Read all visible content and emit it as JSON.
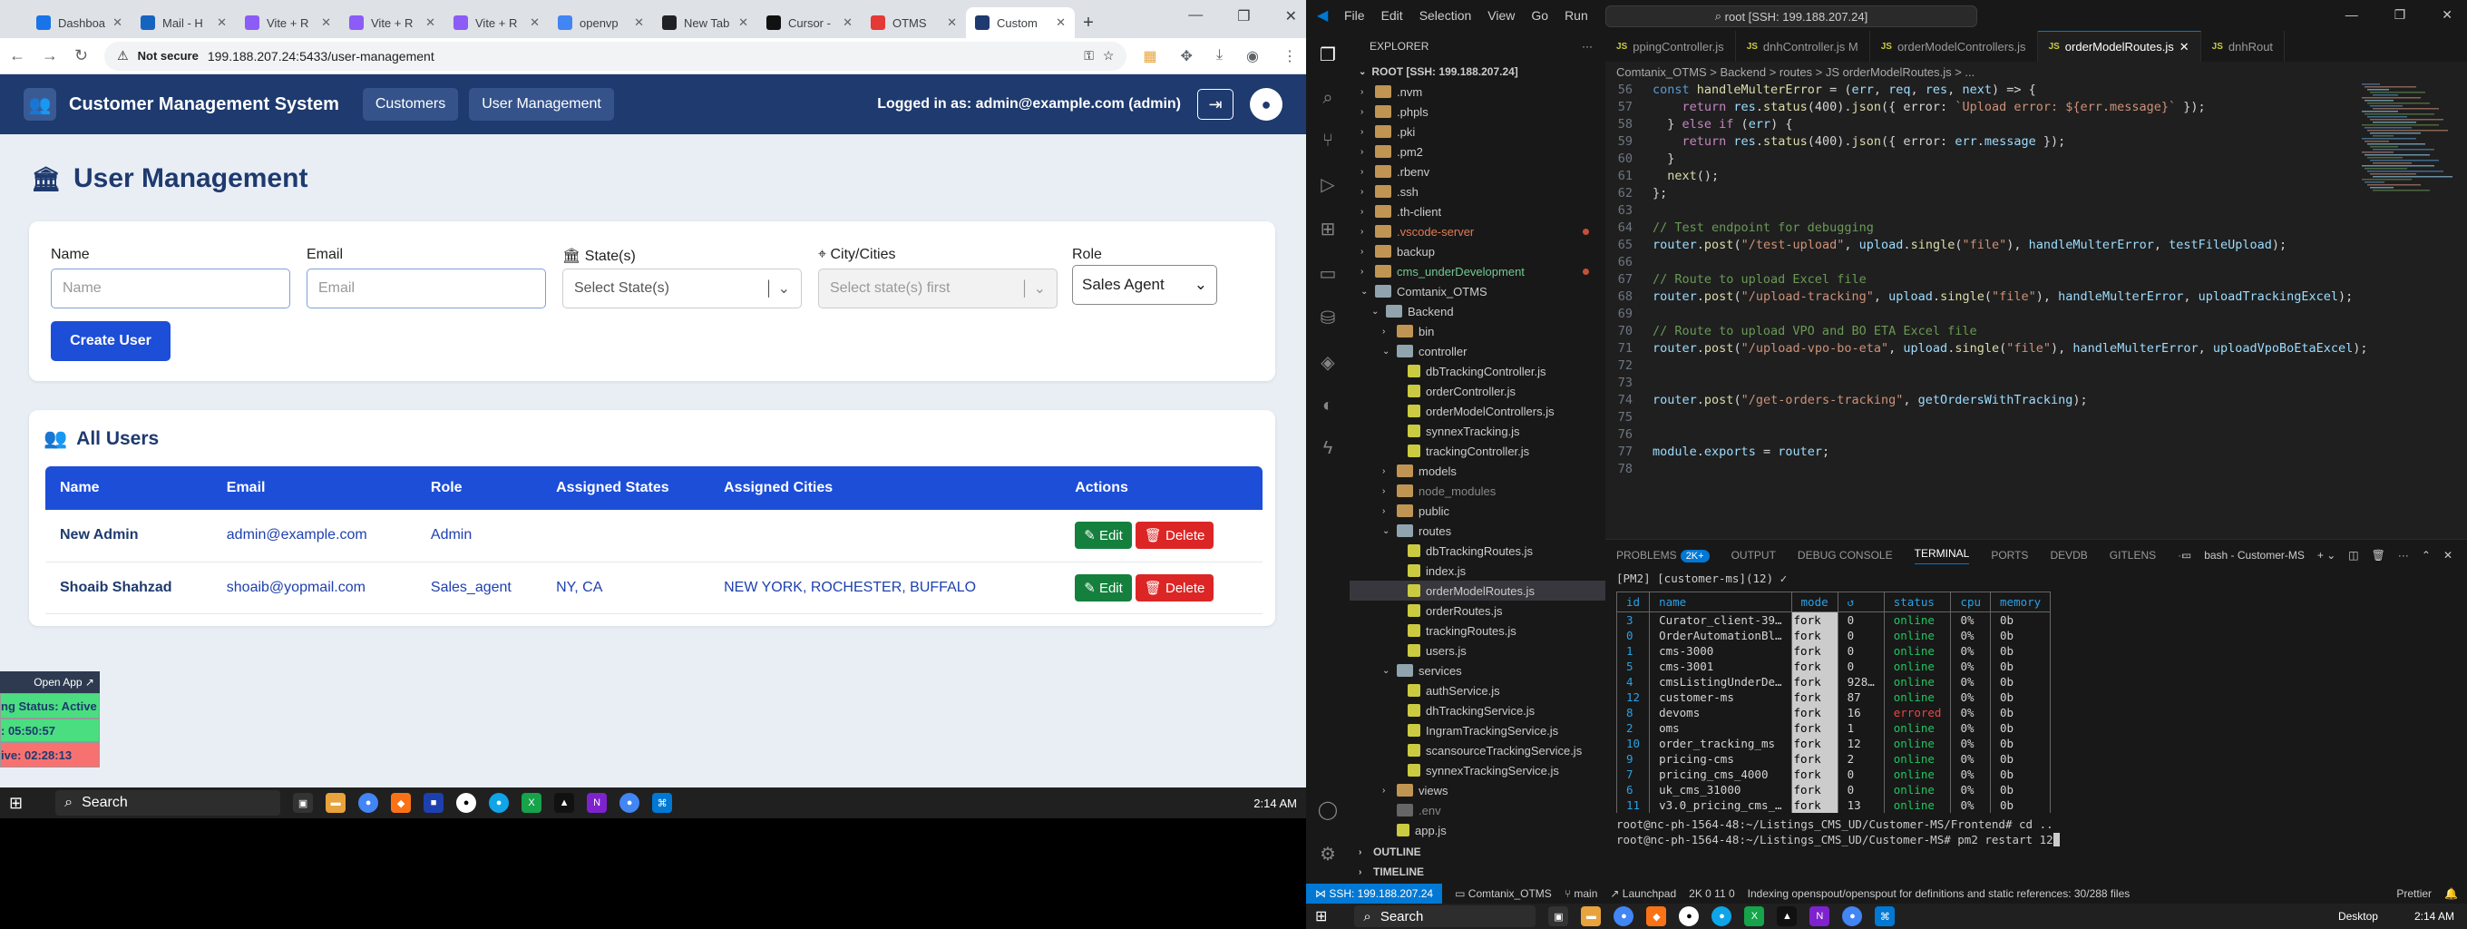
{
  "browser": {
    "tabs": [
      "Dashboa",
      "Mail - H",
      "Vite + R",
      "Vite + R",
      "Vite + R",
      "openvp",
      "New Tab",
      "Cursor -",
      "OTMS",
      "Custom"
    ],
    "tab_colors": [
      "#1a73e8",
      "#1565c0",
      "#8b5cf6",
      "#8b5cf6",
      "#8b5cf6",
      "#4285f4",
      "#202124",
      "#111",
      "#e53935",
      "#1e3a6e"
    ],
    "address": {
      "not_secure": "Not secure",
      "url": "199.188.207.24:5433/user-management"
    }
  },
  "app": {
    "title": "Customer Management System",
    "nav": [
      "Customers",
      "User Management"
    ],
    "logged_in": "Logged in as: admin@example.com (admin)",
    "page_title": "User Management",
    "form": {
      "name_label": "Name",
      "name_placeholder": "Name",
      "email_label": "Email",
      "email_placeholder": "Email",
      "state_label": "State(s)",
      "state_placeholder": "Select State(s)",
      "city_label": "City/Cities",
      "city_placeholder": "Select state(s) first",
      "role_label": "Role",
      "role_value": "Sales Agent",
      "create_button": "Create User"
    },
    "users_heading": "All Users",
    "columns": [
      "Name",
      "Email",
      "Role",
      "Assigned States",
      "Assigned Cities",
      "Actions"
    ],
    "rows": [
      {
        "name": "New Admin",
        "email": "admin@example.com",
        "role": "Admin",
        "states": "",
        "cities": ""
      },
      {
        "name": "Shoaib Shahzad",
        "email": "shoaib@yopmail.com",
        "role": "Sales_agent",
        "states": "NY, CA",
        "cities": "NEW YORK, ROCHESTER, BUFFALO"
      }
    ],
    "edit_label": "Edit",
    "delete_label": "Delete"
  },
  "overlay": {
    "open_app": "Open App ↗",
    "status": "ng Status: Active",
    "t1": ": 05:50:57",
    "t2": "ive: 02:28:13"
  },
  "left_taskbar": {
    "search": "Search",
    "time": "2:14 AM"
  },
  "vscode": {
    "menu": [
      "File",
      "Edit",
      "Selection",
      "View",
      "Go",
      "Run",
      "···"
    ],
    "search": "root [SSH: 199.188.207.24]",
    "explorer_title": "EXPLORER",
    "root": "ROOT [SSH: 199.188.207.24]",
    "tree": [
      {
        "t": ".nvm",
        "d": 1,
        "k": "f"
      },
      {
        "t": ".phpls",
        "d": 1,
        "k": "f"
      },
      {
        "t": ".pki",
        "d": 1,
        "k": "f"
      },
      {
        "t": ".pm2",
        "d": 1,
        "k": "f"
      },
      {
        "t": ".rbenv",
        "d": 1,
        "k": "f"
      },
      {
        "t": ".ssh",
        "d": 1,
        "k": "f"
      },
      {
        "t": ".th-client",
        "d": 1,
        "k": "f"
      },
      {
        "t": ".vscode-server",
        "d": 1,
        "k": "f",
        "c": "#e07b53",
        "dot": true
      },
      {
        "t": "backup",
        "d": 1,
        "k": "f"
      },
      {
        "t": "cms_underDevelopment",
        "d": 1,
        "k": "f",
        "c": "#73c991",
        "dot": true
      },
      {
        "t": "Comtanix_OTMS",
        "d": 1,
        "k": "o"
      },
      {
        "t": "Backend",
        "d": 2,
        "k": "o"
      },
      {
        "t": "bin",
        "d": 3,
        "k": "f"
      },
      {
        "t": "controller",
        "d": 3,
        "k": "o"
      },
      {
        "t": "dbTrackingController.js",
        "d": 4,
        "k": "j"
      },
      {
        "t": "orderController.js",
        "d": 4,
        "k": "j"
      },
      {
        "t": "orderModelControllers.js",
        "d": 4,
        "k": "j"
      },
      {
        "t": "synnexTracking.js",
        "d": 4,
        "k": "j"
      },
      {
        "t": "trackingController.js",
        "d": 4,
        "k": "j"
      },
      {
        "t": "models",
        "d": 3,
        "k": "f"
      },
      {
        "t": "node_modules",
        "d": 3,
        "k": "f",
        "c": "#888"
      },
      {
        "t": "public",
        "d": 3,
        "k": "f"
      },
      {
        "t": "routes",
        "d": 3,
        "k": "o"
      },
      {
        "t": "dbTrackingRoutes.js",
        "d": 4,
        "k": "j"
      },
      {
        "t": "index.js",
        "d": 4,
        "k": "j"
      },
      {
        "t": "orderModelRoutes.js",
        "d": 4,
        "k": "j",
        "sel": true
      },
      {
        "t": "orderRoutes.js",
        "d": 4,
        "k": "j"
      },
      {
        "t": "trackingRoutes.js",
        "d": 4,
        "k": "j"
      },
      {
        "t": "users.js",
        "d": 4,
        "k": "j"
      },
      {
        "t": "services",
        "d": 3,
        "k": "o"
      },
      {
        "t": "authService.js",
        "d": 4,
        "k": "j"
      },
      {
        "t": "dhTrackingService.js",
        "d": 4,
        "k": "j"
      },
      {
        "t": "IngramTrackingService.js",
        "d": 4,
        "k": "j"
      },
      {
        "t": "scansourceTrackingService.js",
        "d": 4,
        "k": "j"
      },
      {
        "t": "synnexTrackingService.js",
        "d": 4,
        "k": "j"
      },
      {
        "t": "views",
        "d": 3,
        "k": "f"
      },
      {
        "t": ".env",
        "d": 3,
        "k": "e",
        "c": "#888"
      },
      {
        "t": "app.js",
        "d": 3,
        "k": "j"
      }
    ],
    "outline": "OUTLINE",
    "timeline": "TIMELINE",
    "editor_tabs": [
      "ppingController.js",
      "dnhController.js M",
      "orderModelControllers.js",
      "orderModelRoutes.js",
      "dnhRout"
    ],
    "breadcrumb": "Comtanix_OTMS > Backend > routes > JS orderModelRoutes.js > ...",
    "code": [
      {
        "n": "56",
        "s": [
          [
            "kw",
            "const "
          ],
          [
            "fn",
            "handleMulterError"
          ],
          [
            "pl",
            " = ("
          ],
          [
            "var",
            "err"
          ],
          [
            "pl",
            ", "
          ],
          [
            "var",
            "req"
          ],
          [
            "pl",
            ", "
          ],
          [
            "var",
            "res"
          ],
          [
            "pl",
            ", "
          ],
          [
            "var",
            "next"
          ],
          [
            "pl",
            ") => {"
          ]
        ]
      },
      {
        "n": "57",
        "s": [
          [
            "pl",
            "    "
          ],
          [
            "kw2",
            "return "
          ],
          [
            "var",
            "res"
          ],
          [
            "pl",
            "."
          ],
          [
            "fn",
            "status"
          ],
          [
            "pl",
            "(400)."
          ],
          [
            "fn",
            "json"
          ],
          [
            "pl",
            "({ error: "
          ],
          [
            "str",
            "`Upload error: ${err.message}`"
          ],
          [
            "pl",
            " });"
          ]
        ]
      },
      {
        "n": "58",
        "s": [
          [
            "pl",
            "  } "
          ],
          [
            "kw2",
            "else if"
          ],
          [
            "pl",
            " ("
          ],
          [
            "var",
            "err"
          ],
          [
            "pl",
            ") {"
          ]
        ]
      },
      {
        "n": "59",
        "s": [
          [
            "pl",
            "    "
          ],
          [
            "kw2",
            "return "
          ],
          [
            "var",
            "res"
          ],
          [
            "pl",
            "."
          ],
          [
            "fn",
            "status"
          ],
          [
            "pl",
            "(400)."
          ],
          [
            "fn",
            "json"
          ],
          [
            "pl",
            "({ error: "
          ],
          [
            "var",
            "err"
          ],
          [
            "pl",
            "."
          ],
          [
            "var",
            "message"
          ],
          [
            "pl",
            " });"
          ]
        ]
      },
      {
        "n": "60",
        "s": [
          [
            "pl",
            "  }"
          ]
        ]
      },
      {
        "n": "61",
        "s": [
          [
            "pl",
            "  "
          ],
          [
            "fn",
            "next"
          ],
          [
            "pl",
            "();"
          ]
        ]
      },
      {
        "n": "62",
        "s": [
          [
            "pl",
            "};"
          ]
        ]
      },
      {
        "n": "63",
        "s": [
          [
            "pl",
            ""
          ]
        ]
      },
      {
        "n": "64",
        "s": [
          [
            "cm",
            "// Test endpoint for debugging"
          ]
        ]
      },
      {
        "n": "65",
        "s": [
          [
            "var",
            "router"
          ],
          [
            "pl",
            "."
          ],
          [
            "fn",
            "post"
          ],
          [
            "pl",
            "("
          ],
          [
            "str",
            "\"/test-upload\""
          ],
          [
            "pl",
            ", "
          ],
          [
            "var",
            "upload"
          ],
          [
            "pl",
            "."
          ],
          [
            "fn",
            "single"
          ],
          [
            "pl",
            "("
          ],
          [
            "str",
            "\"file\""
          ],
          [
            "pl",
            "), "
          ],
          [
            "var",
            "handleMulterError"
          ],
          [
            "pl",
            ", "
          ],
          [
            "var",
            "testFileUpload"
          ],
          [
            "pl",
            ");"
          ]
        ]
      },
      {
        "n": "66",
        "s": [
          [
            "pl",
            ""
          ]
        ]
      },
      {
        "n": "67",
        "s": [
          [
            "cm",
            "// Route to upload Excel file"
          ]
        ]
      },
      {
        "n": "68",
        "s": [
          [
            "var",
            "router"
          ],
          [
            "pl",
            "."
          ],
          [
            "fn",
            "post"
          ],
          [
            "pl",
            "("
          ],
          [
            "str",
            "\"/upload-tracking\""
          ],
          [
            "pl",
            ", "
          ],
          [
            "var",
            "upload"
          ],
          [
            "pl",
            "."
          ],
          [
            "fn",
            "single"
          ],
          [
            "pl",
            "("
          ],
          [
            "str",
            "\"file\""
          ],
          [
            "pl",
            "), "
          ],
          [
            "var",
            "handleMulterError"
          ],
          [
            "pl",
            ", "
          ],
          [
            "var",
            "uploadTrackingExcel"
          ],
          [
            "pl",
            ");"
          ]
        ]
      },
      {
        "n": "69",
        "s": [
          [
            "pl",
            ""
          ]
        ]
      },
      {
        "n": "70",
        "s": [
          [
            "cm",
            "// Route to upload VPO and BO ETA Excel file"
          ]
        ]
      },
      {
        "n": "71",
        "s": [
          [
            "var",
            "router"
          ],
          [
            "pl",
            "."
          ],
          [
            "fn",
            "post"
          ],
          [
            "pl",
            "("
          ],
          [
            "str",
            "\"/upload-vpo-bo-eta\""
          ],
          [
            "pl",
            ", "
          ],
          [
            "var",
            "upload"
          ],
          [
            "pl",
            "."
          ],
          [
            "fn",
            "single"
          ],
          [
            "pl",
            "("
          ],
          [
            "str",
            "\"file\""
          ],
          [
            "pl",
            "), "
          ],
          [
            "var",
            "handleMulterError"
          ],
          [
            "pl",
            ", "
          ],
          [
            "var",
            "uploadVpoBoEtaExcel"
          ],
          [
            "pl",
            ");"
          ]
        ]
      },
      {
        "n": "72",
        "s": [
          [
            "pl",
            ""
          ]
        ]
      },
      {
        "n": "73",
        "s": [
          [
            "pl",
            ""
          ]
        ]
      },
      {
        "n": "74",
        "s": [
          [
            "var",
            "router"
          ],
          [
            "pl",
            "."
          ],
          [
            "fn",
            "post"
          ],
          [
            "pl",
            "("
          ],
          [
            "str",
            "\"/get-orders-tracking\""
          ],
          [
            "pl",
            ", "
          ],
          [
            "var",
            "getOrdersWithTracking"
          ],
          [
            "pl",
            ");"
          ]
        ]
      },
      {
        "n": "75",
        "s": [
          [
            "pl",
            ""
          ]
        ]
      },
      {
        "n": "76",
        "s": [
          [
            "pl",
            ""
          ]
        ]
      },
      {
        "n": "77",
        "s": [
          [
            "var",
            "module"
          ],
          [
            "pl",
            "."
          ],
          [
            "var",
            "exports"
          ],
          [
            "pl",
            " = "
          ],
          [
            "var",
            "router"
          ],
          [
            "pl",
            ";"
          ]
        ]
      },
      {
        "n": "78",
        "s": [
          [
            "pl",
            ""
          ]
        ]
      }
    ],
    "panel_tabs": [
      "PROBLEMS",
      "OUTPUT",
      "DEBUG CONSOLE",
      "TERMINAL",
      "PORTS",
      "DEVDB",
      "GITLENS"
    ],
    "problems_count": "2K+",
    "terminal_name": "bash - Customer-MS",
    "pm2_line": "[PM2] [customer-ms](12) ✓",
    "pm2_headers": [
      "id",
      "name",
      "mode",
      "↺",
      "status",
      "cpu",
      "memory"
    ],
    "pm2_rows": [
      [
        "3",
        "Curator_client-39…",
        "fork",
        "0",
        "online",
        "0%",
        "0b"
      ],
      [
        "0",
        "OrderAutomationBl…",
        "fork",
        "0",
        "online",
        "0%",
        "0b"
      ],
      [
        "1",
        "cms-3000",
        "fork",
        "0",
        "online",
        "0%",
        "0b"
      ],
      [
        "5",
        "cms-3001",
        "fork",
        "0",
        "online",
        "0%",
        "0b"
      ],
      [
        "4",
        "cmsListingUnderDe…",
        "fork",
        "928…",
        "online",
        "0%",
        "0b"
      ],
      [
        "12",
        "customer-ms",
        "fork",
        "87",
        "online",
        "0%",
        "0b"
      ],
      [
        "8",
        "devoms",
        "fork",
        "16",
        "errored",
        "0%",
        "0b"
      ],
      [
        "2",
        "oms",
        "fork",
        "1",
        "online",
        "0%",
        "0b"
      ],
      [
        "10",
        "order_tracking_ms",
        "fork",
        "12",
        "online",
        "0%",
        "0b"
      ],
      [
        "9",
        "pricing-cms",
        "fork",
        "2",
        "online",
        "0%",
        "0b"
      ],
      [
        "7",
        "pricing_cms_4000",
        "fork",
        "0",
        "online",
        "0%",
        "0b"
      ],
      [
        "6",
        "uk_cms_31000",
        "fork",
        "0",
        "online",
        "0%",
        "0b"
      ],
      [
        "11",
        "v3.0_pricing_cms_…",
        "fork",
        "13",
        "online",
        "0%",
        "0b"
      ]
    ],
    "prompt1": "root@nc-ph-1564-48:~/Listings_CMS_UD/Customer-MS/Frontend# cd ..",
    "prompt2": "root@nc-ph-1564-48:~/Listings_CMS_UD/Customer-MS# pm2 restart 12",
    "status": {
      "ssh": "SSH: 199.188.207.24",
      "folder": "Comtanix_OTMS",
      "branch": "main",
      "launchpad": "Launchpad",
      "counts": "2K  0  11  0",
      "indexing": "Indexing openspout/openspout for definitions and static references: 30/288 files",
      "prettier": "Prettier"
    },
    "taskbar": {
      "search": "Search",
      "desktop": "Desktop",
      "time": "2:14 AM"
    }
  }
}
